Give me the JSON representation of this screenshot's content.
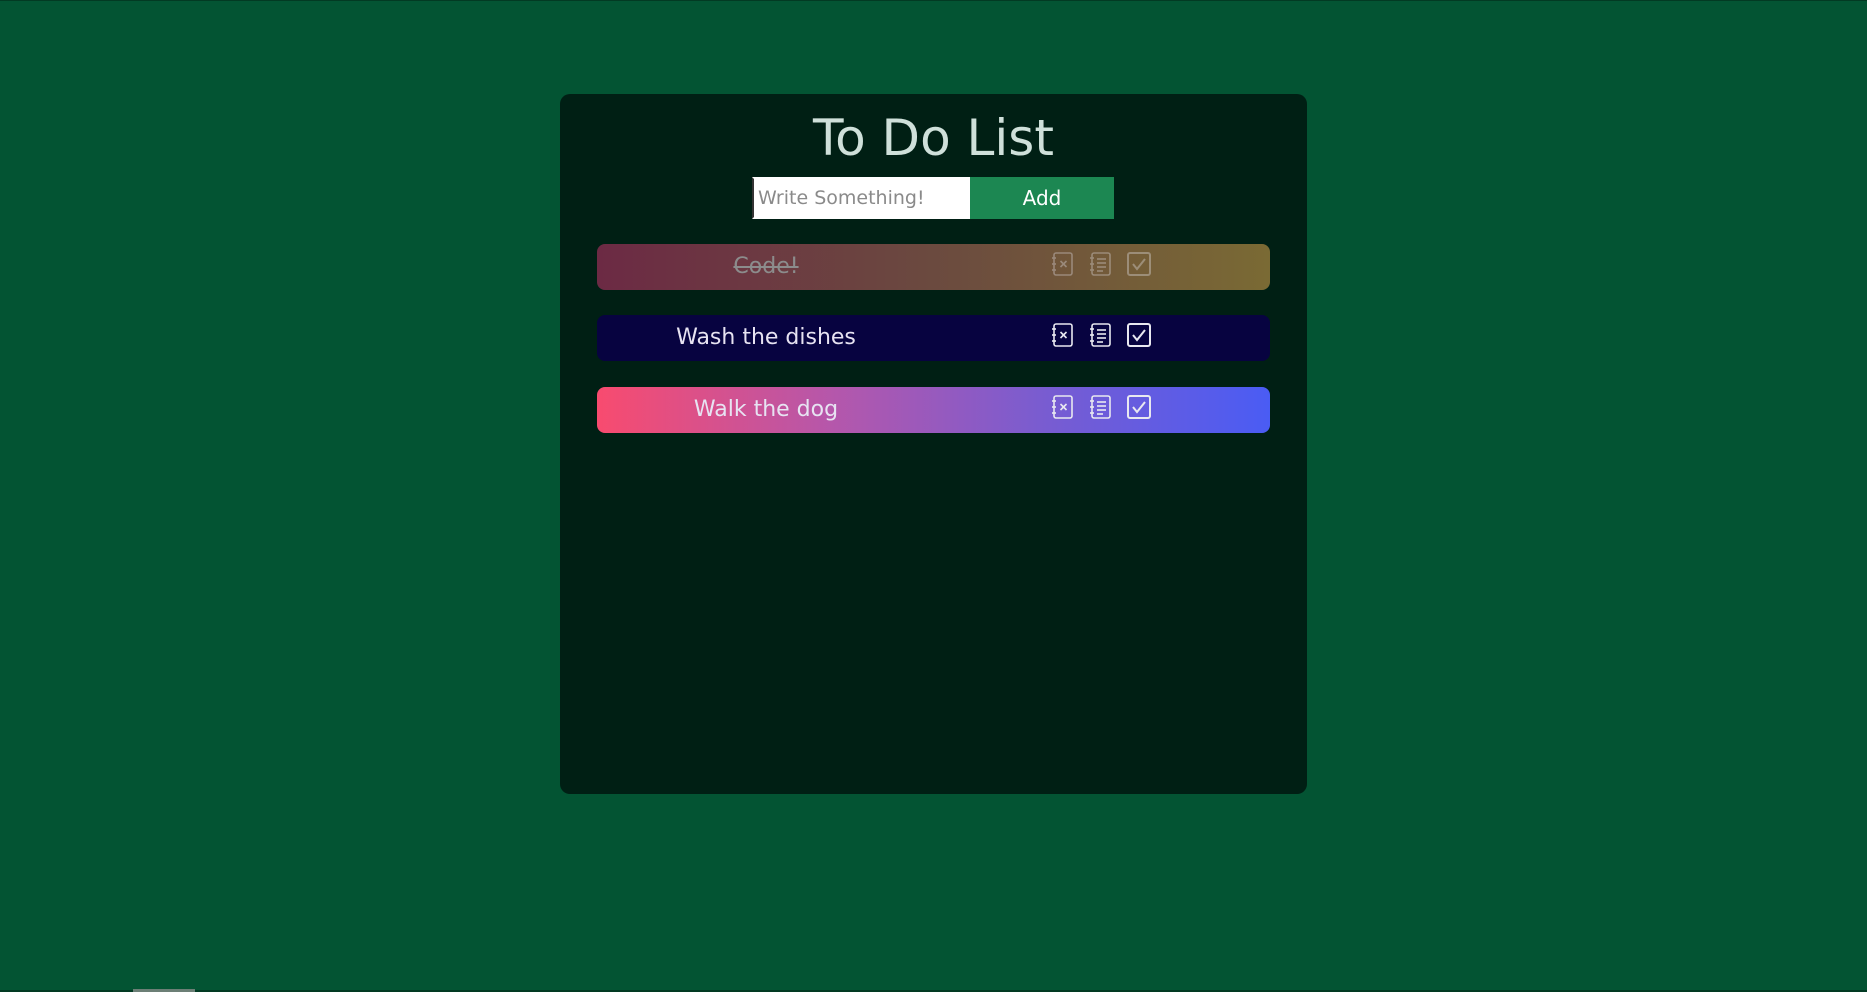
{
  "app": {
    "title": "To Do List"
  },
  "form": {
    "input_placeholder": "Write Something!",
    "input_value": "",
    "add_label": "Add"
  },
  "todos": [
    {
      "text": "Code!",
      "completed": true
    },
    {
      "text": "Wash the dishes",
      "completed": false
    },
    {
      "text": "Walk the dog",
      "completed": false
    }
  ],
  "icons": {
    "delete": "delete-icon",
    "edit": "edit-icon",
    "complete": "check-icon"
  },
  "colors": {
    "page_background": "#035433",
    "panel_background": "#001f14",
    "add_button": "#1c8752",
    "todo_2_background": "#070340"
  }
}
